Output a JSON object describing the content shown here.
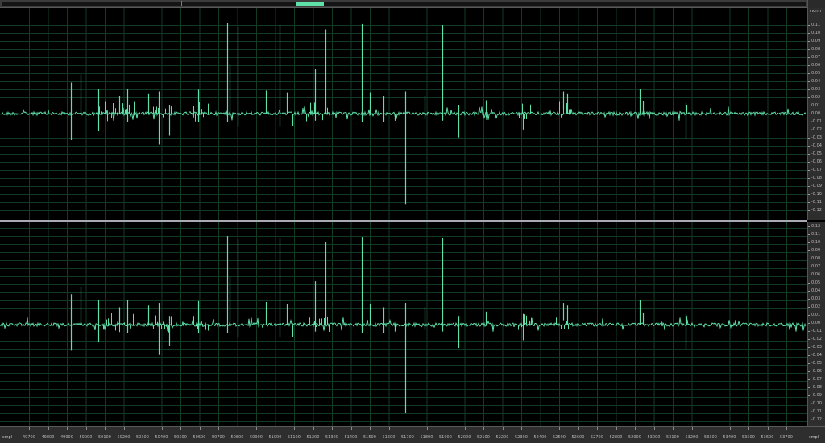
{
  "window": {
    "background": "#000000",
    "waveform_color": "#5fe0a8",
    "grid_color": "#123a24",
    "divider_color": "#a9a9b3"
  },
  "overview": {
    "view_start_fraction": 0.368,
    "view_width_fraction": 0.034
  },
  "amplitude_ruler": {
    "unit": "norm",
    "channel_1_labels": [
      "0.11",
      "0.10",
      "0.09",
      "0.08",
      "0.07",
      "0.06",
      "0.05",
      "0.04",
      "0.03",
      "0.02",
      "0.01",
      "0.00",
      "-0.01",
      "-0.02",
      "-0.03",
      "-0.04",
      "-0.05",
      "-0.06",
      "-0.07",
      "-0.08",
      "-0.09",
      "-0.10",
      "-0.11",
      "-0.12"
    ],
    "channel_2_labels": [
      "0.12",
      "0.11",
      "0.10",
      "0.09",
      "0.08",
      "0.07",
      "0.06",
      "0.05",
      "0.04",
      "0.03",
      "0.02",
      "0.01",
      "0.00",
      "-0.01",
      "-0.02",
      "-0.03",
      "-0.04",
      "-0.05",
      "-0.06",
      "-0.07",
      "-0.08",
      "-0.09",
      "-0.10",
      "-0.11",
      "-0.12"
    ]
  },
  "time_ruler": {
    "unit_left": "smpl",
    "unit_right": "smpl",
    "labels": [
      "49700",
      "49800",
      "49900",
      "50000",
      "50100",
      "50200",
      "50300",
      "50400",
      "50500",
      "50600",
      "50700",
      "50800",
      "50900",
      "51000",
      "51100",
      "51200",
      "51300",
      "51400",
      "51500",
      "51600",
      "51700",
      "51800",
      "51900",
      "52000",
      "52100",
      "52200",
      "52300",
      "52400",
      "52500",
      "52600",
      "52700",
      "52800",
      "52900",
      "53000",
      "53100",
      "53200",
      "53300",
      "53400",
      "53500",
      "53600",
      "53700"
    ]
  }
}
